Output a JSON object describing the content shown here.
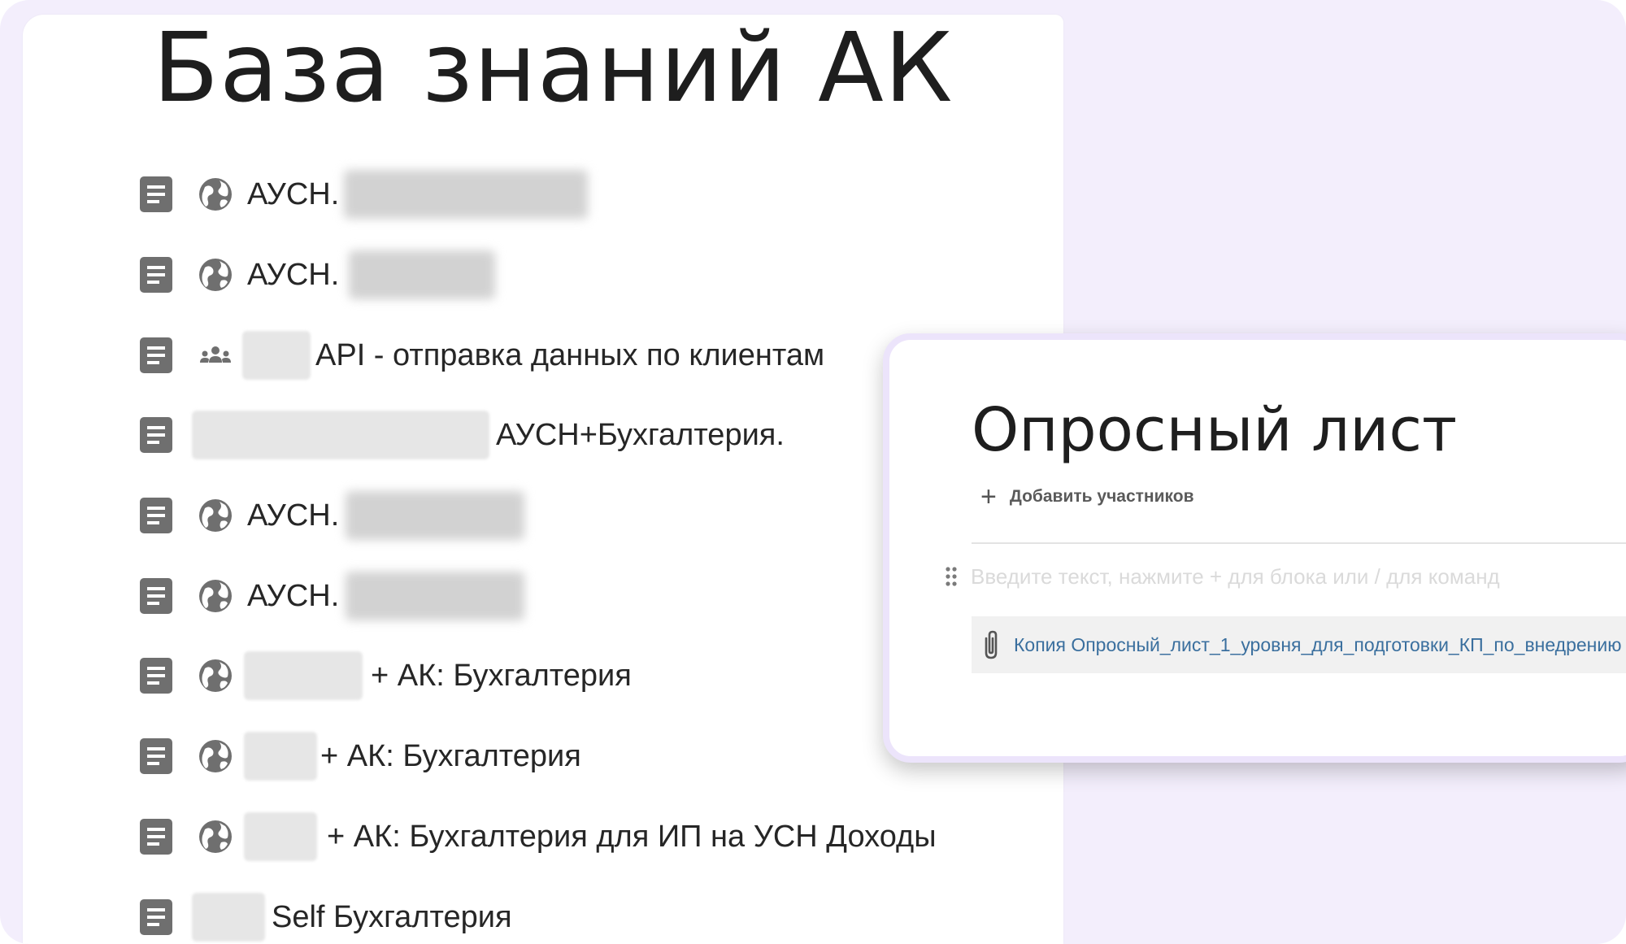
{
  "kb": {
    "title": "База знаний АК",
    "rows": [
      {
        "prefix": "АУСН.",
        "suffix": ""
      },
      {
        "prefix": "АУСН.",
        "suffix": ""
      },
      {
        "prefix": "",
        "suffix": "API - отправка данных по клиентам"
      },
      {
        "prefix": "",
        "suffix": "АУСН+Бухгалтерия."
      },
      {
        "prefix": "АУСН.",
        "suffix": ""
      },
      {
        "prefix": "АУСН.",
        "suffix": ""
      },
      {
        "prefix": "",
        "suffix": "+ АК: Бухгалтерия"
      },
      {
        "prefix": "",
        "suffix": "+ АК: Бухгалтерия"
      },
      {
        "prefix": "",
        "suffix": "+ АК: Бухгалтерия для ИП на УСН Доходы"
      },
      {
        "prefix": "",
        "suffix": "Self Бухгалтерия"
      }
    ]
  },
  "card": {
    "title": "Опросный лист",
    "add_members": "Добавить участников",
    "input_placeholder": "Введите текст, нажмите + для блока или / для команд",
    "attachment": "Копия Опросный_лист_1_уровня_для_подготовки_КП_по_внедрению"
  },
  "icons": {
    "document": "document-icon",
    "public": "globe-icon",
    "team": "group-icon",
    "attachment": "paperclip-icon",
    "add": "plus-icon",
    "drag": "drag-handle-icon"
  },
  "colors": {
    "background": "#f3eefc",
    "icon_gray": "#6f6f6f",
    "link_blue": "#3a6f9e",
    "card_border": "#ece4fb"
  }
}
